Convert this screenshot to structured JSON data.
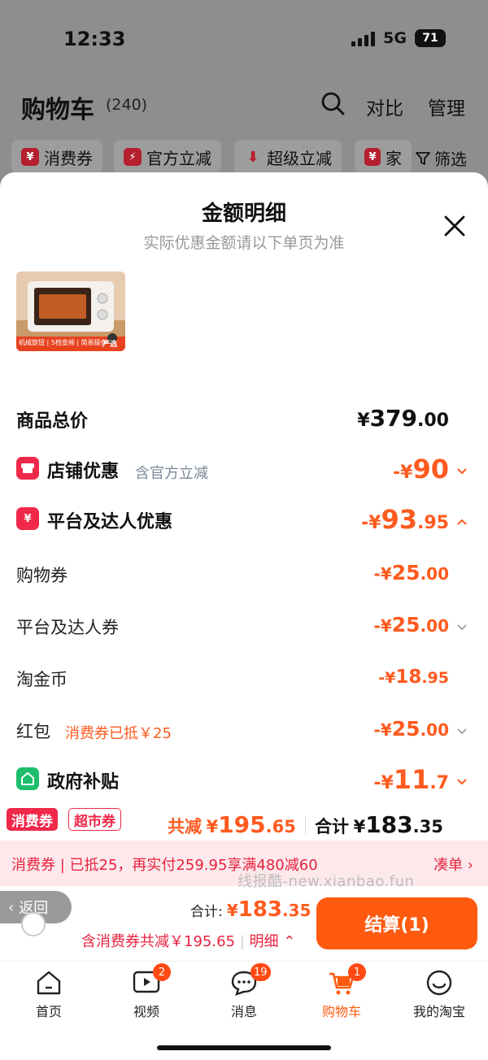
{
  "status": {
    "time": "12:33",
    "network": "5G",
    "battery": "71"
  },
  "header": {
    "title": "购物车",
    "count": "(240)",
    "compare": "对比",
    "manage": "管理"
  },
  "filters": {
    "chips": [
      "消费券",
      "官方立减",
      "超级立减",
      "家"
    ],
    "filter": "筛选"
  },
  "sheet": {
    "title": "金额明细",
    "subtitle": "实际优惠金额请以下单页为准",
    "product_caption": "机械旋钮 | 5档变频 | 简易操作",
    "product_badge": "严选",
    "rows": {
      "total": {
        "label": "商品总价",
        "cur": "¥",
        "main": "379",
        "dec": ".00"
      },
      "store": {
        "label": "店铺优惠",
        "note": "含官方立减",
        "cur": "-¥",
        "main": "90",
        "dec": ""
      },
      "platform": {
        "label": "平台及达人优惠",
        "cur": "-¥",
        "main": "93",
        "dec": ".95"
      },
      "coupon": {
        "label": "购物券",
        "cur": "-¥",
        "main": "25",
        "dec": ".00"
      },
      "creator": {
        "label": "平台及达人券",
        "cur": "-¥",
        "main": "25",
        "dec": ".00"
      },
      "gold": {
        "label": "淘金币",
        "cur": "-¥",
        "main": "18",
        "dec": ".95"
      },
      "redpacket": {
        "label": "红包",
        "note": "消费券已抵￥25",
        "cur": "-¥",
        "main": "25",
        "dec": ".00"
      },
      "gov": {
        "label": "政府补贴",
        "cur": "-¥",
        "main": "11",
        "dec": ".7"
      }
    }
  },
  "summary": {
    "tag1": "消费券",
    "tag2": "超市券",
    "saved_label": "共减",
    "saved_cur": "¥",
    "saved_main": "195",
    "saved_dec": ".65",
    "total_label": "合计",
    "total_cur": "¥",
    "total_main": "183",
    "total_dec": ".35"
  },
  "promo": {
    "text": "消费券 | 已抵25，再实付259.95享满480减60",
    "action": "凑单"
  },
  "watermark": "线报酷-new.xianbao.fun",
  "checkout": {
    "back": "返回",
    "sum_label": "合计:",
    "sum_cur": "¥",
    "sum_main": "183",
    "sum_dec": ".35",
    "discount": "含消费券共减￥195.65",
    "detail": "明细",
    "pay": "结算(1)"
  },
  "tabs": [
    {
      "label": "首页",
      "badge": ""
    },
    {
      "label": "视频",
      "badge": "2"
    },
    {
      "label": "消息",
      "badge": "19"
    },
    {
      "label": "购物车",
      "badge": "1"
    },
    {
      "label": "我的淘宝",
      "badge": ""
    }
  ],
  "colors": {
    "accent": "#ff5a0f",
    "price": "#ff5a1f",
    "red": "#e8223e",
    "green": "#1dbf6c"
  }
}
